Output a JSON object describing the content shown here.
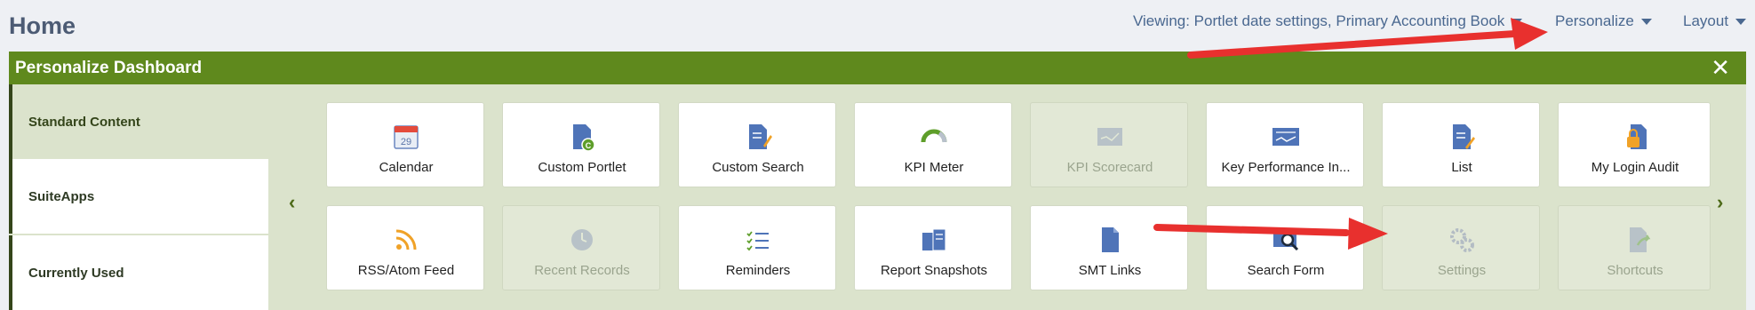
{
  "header": {
    "title": "Home",
    "viewing": "Viewing: Portlet date settings, Primary Accounting Book",
    "personalize": "Personalize",
    "layout": "Layout"
  },
  "panel": {
    "title": "Personalize Dashboard",
    "close": "✕"
  },
  "sidebar": {
    "items": [
      {
        "label": "Standard Content"
      },
      {
        "label": "SuiteApps"
      },
      {
        "label": "Currently Used"
      }
    ]
  },
  "nav": {
    "prev": "‹",
    "next": "›"
  },
  "tiles": [
    {
      "label": "Calendar",
      "icon": "calendar-icon"
    },
    {
      "label": "Custom Portlet",
      "icon": "custom-portlet-icon"
    },
    {
      "label": "Custom Search",
      "icon": "custom-search-icon"
    },
    {
      "label": "KPI Meter",
      "icon": "kpi-meter-icon"
    },
    {
      "label": "KPI Scorecard",
      "icon": "kpi-scorecard-icon"
    },
    {
      "label": "Key Performance In...",
      "icon": "key-performance-icon"
    },
    {
      "label": "List",
      "icon": "list-icon"
    },
    {
      "label": "My Login Audit",
      "icon": "login-audit-icon"
    },
    {
      "label": "RSS/Atom Feed",
      "icon": "rss-icon"
    },
    {
      "label": "Recent Records",
      "icon": "clock-icon"
    },
    {
      "label": "Reminders",
      "icon": "checklist-icon"
    },
    {
      "label": "Report Snapshots",
      "icon": "report-snapshots-icon"
    },
    {
      "label": "SMT Links",
      "icon": "document-icon"
    },
    {
      "label": "Search Form",
      "icon": "search-form-icon"
    },
    {
      "label": "Settings",
      "icon": "gear-icon"
    },
    {
      "label": "Shortcuts",
      "icon": "shortcuts-icon"
    }
  ],
  "colors": {
    "header_green": "#5f891d",
    "body_green": "#dbe3cc",
    "accent_blue": "#4a6890",
    "arrow_red": "#e8302e"
  }
}
